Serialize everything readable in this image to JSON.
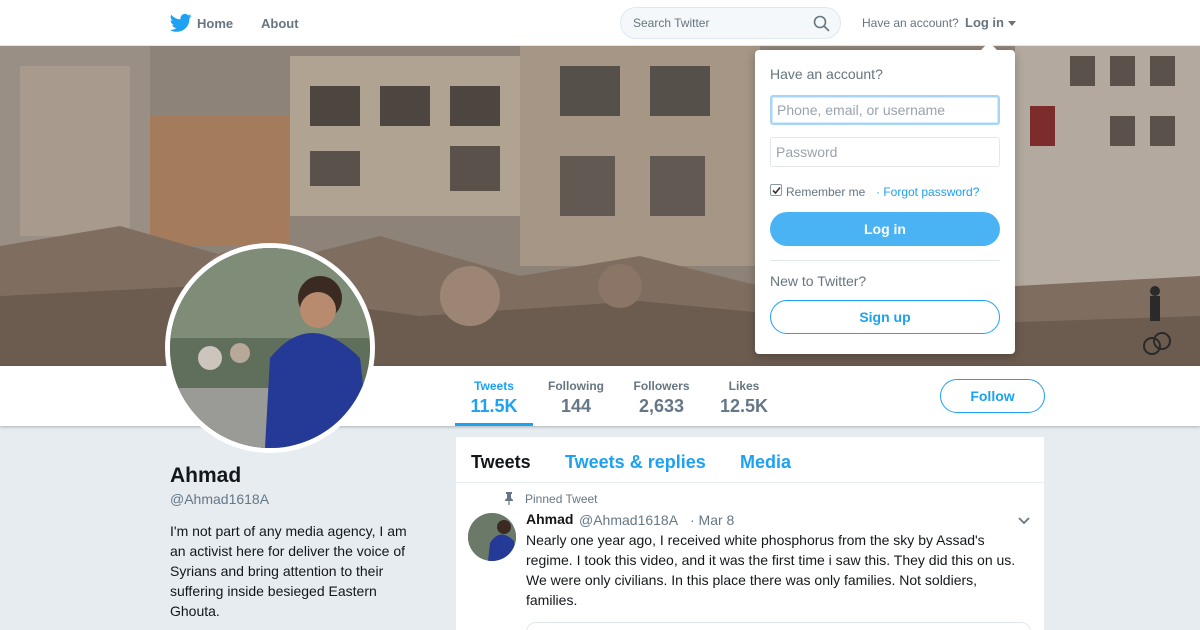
{
  "nav": {
    "home_label": "Home",
    "about_label": "About",
    "search_placeholder": "Search Twitter",
    "have_account": "Have an account?",
    "login_label": "Log in"
  },
  "profile": {
    "name": "Ahmad",
    "handle": "@Ahmad1618A",
    "bio": "I'm not part of any media agency, I am an activist here for deliver the voice of Syrians and bring attention to their suffering inside besieged Eastern Ghouta.",
    "follow_label": "Follow",
    "stats": [
      {
        "label": "Tweets",
        "value": "11.5K"
      },
      {
        "label": "Following",
        "value": "144"
      },
      {
        "label": "Followers",
        "value": "2,633"
      },
      {
        "label": "Likes",
        "value": "12.5K"
      }
    ]
  },
  "timeline": {
    "tabs": [
      "Tweets",
      "Tweets & replies",
      "Media"
    ],
    "pinned_label": "Pinned Tweet",
    "tweet": {
      "name": "Ahmad",
      "handle": "@Ahmad1618A",
      "date": "· Mar 8",
      "text": "Nearly one year ago, I received white phosphorus from the sky by Assad's regime. I took this video, and it was the first time i saw this. They did this on us. We were only civilians. In this place there was only families. Not soldiers, families."
    }
  },
  "login_dropdown": {
    "title": "Have an account?",
    "username_placeholder": "Phone, email, or username",
    "password_placeholder": "Password",
    "remember_label": "Remember me",
    "forgot_label": "· Forgot password?",
    "login_button": "Log in",
    "new_label": "New to Twitter?",
    "signup_button": "Sign up",
    "remember_checked": true
  },
  "colors": {
    "accent": "#1da1f2",
    "login_button_bg": "#4ab3f4",
    "page_bg": "#e6ecf0"
  },
  "icons": [
    "twitter-bird-icon",
    "search-icon",
    "caret-down-icon",
    "pin-icon",
    "chevron-down-icon",
    "checkmark-icon"
  ]
}
